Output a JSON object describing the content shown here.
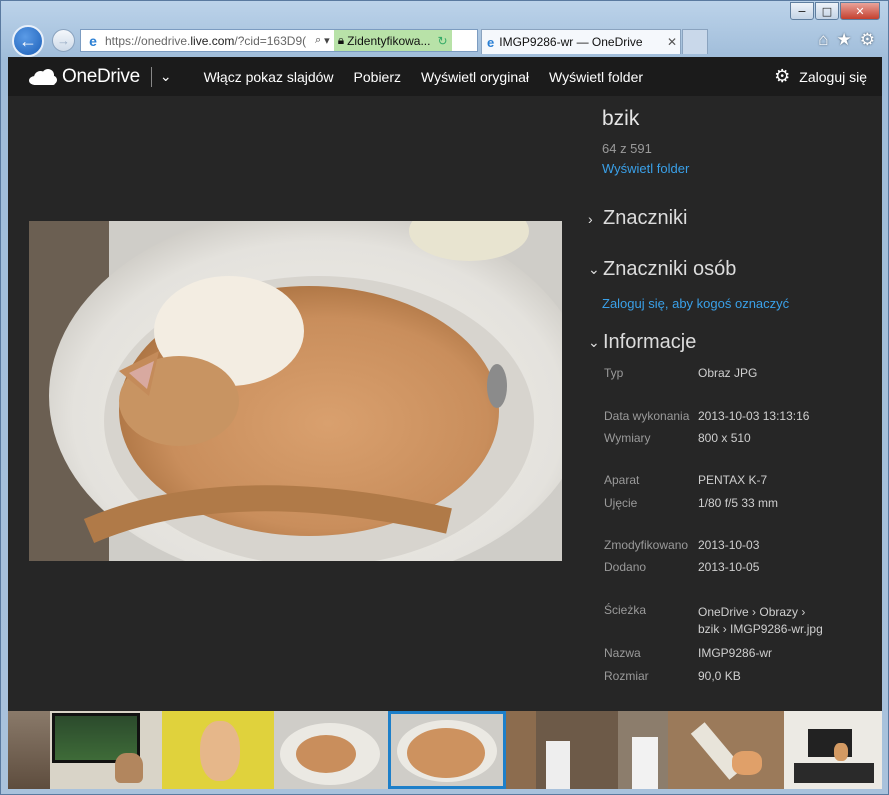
{
  "browser": {
    "url_main": "https://onedrive.",
    "url_bold": "live.com",
    "url_rest": "/?cid=163D9(",
    "security_label": "Zidentyfikowa...",
    "tab_title": "IMGP9286-wr — OneDrive",
    "window_controls": [
      "−",
      "□",
      "✕"
    ]
  },
  "app": {
    "brand": "OneDrive",
    "nav": [
      "Włącz pokaz slajdów",
      "Pobierz",
      "Wyświetl oryginał",
      "Wyświetl folder"
    ],
    "login": "Zaloguj się"
  },
  "panel": {
    "title": "bzik",
    "count": "64 z 591",
    "view_folder": "Wyświetl folder",
    "sections": {
      "tags": "Znaczniki",
      "people": "Znaczniki osób",
      "info": "Informacje"
    },
    "people_link": "Zaloguj się, aby kogoś oznaczyć",
    "info": {
      "type_label": "Typ",
      "type": "Obraz JPG",
      "date_label": "Data wykonania",
      "date": "2013-10-03 13:13:16",
      "dims_label": "Wymiary",
      "dims": "800 x 510",
      "camera_label": "Aparat",
      "camera": "PENTAX K-7",
      "shot_label": "Ujęcie",
      "shot": "1/80 f/5 33 mm",
      "modified_label": "Zmodyfikowano",
      "modified": "2013-10-03",
      "added_label": "Dodano",
      "added": "2013-10-05",
      "path_label": "Ścieżka",
      "path1": "OneDrive",
      "path2": "Obrazy",
      "path3": "bzik",
      "path4": "IMGP9286-wr.jpg",
      "name_label": "Nazwa",
      "name": "IMGP9286-wr",
      "size_label": "Rozmiar",
      "size": "90,0 KB"
    }
  },
  "filmstrip": {
    "thumbnails": [
      "cat",
      "cat-with-tv",
      "kitten-on-yellow",
      "cat-in-sink",
      "cat-in-sink",
      "kitchen-cat",
      "fridge-cat",
      "scratching-post-cat",
      "tv-stand-cat"
    ],
    "active_index": 4
  }
}
